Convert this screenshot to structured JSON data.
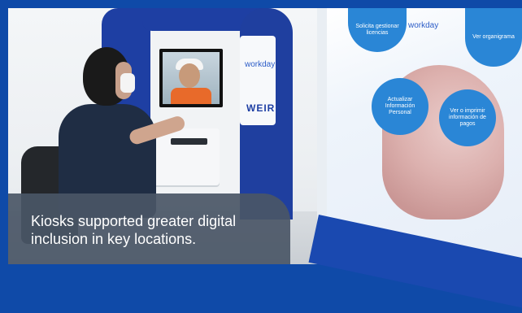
{
  "caption": {
    "text": "Kiosks supported greater digital inclusion in key locations."
  },
  "kiosk_panel": {
    "brand_workday": "workday",
    "brand_weir": "WEIR"
  },
  "poster": {
    "brand_workday": "workday",
    "bubble_top_left": "Solicita gestionar licencias",
    "bubble_top_right": "Ver organigrama",
    "bubble_mid_left": "Actualizar Información Personal",
    "bubble_mid_right": "Ver o imprimir información de pagos"
  },
  "colors": {
    "brand_blue": "#0f4aa8",
    "caption_bg": "#4a5666",
    "accent_blue": "#2a86d6"
  }
}
